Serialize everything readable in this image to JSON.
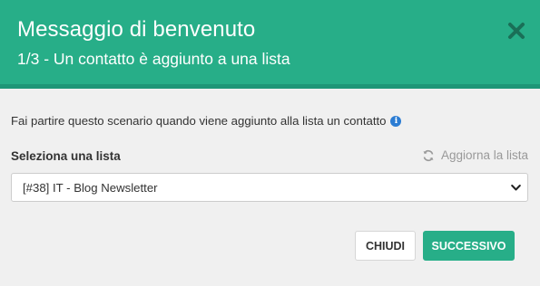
{
  "header": {
    "title": "Messaggio di benvenuto",
    "subtitle": "1/3 - Un contatto è aggiunto a una lista"
  },
  "body": {
    "description": "Fai partire questo scenario quando viene aggiunto alla lista un contatto",
    "select_label": "Seleziona una lista",
    "refresh_label": "Aggiorna la lista",
    "select_value": "[#38] IT - Blog Newsletter"
  },
  "footer": {
    "close_label": "CHIUDI",
    "next_label": "SUCCESSIVO"
  },
  "colors": {
    "accent": "#27ae88",
    "accent_dark": "#1e9677",
    "info": "#2b7cd3",
    "background": "#f0f0f0"
  },
  "icons": {
    "close": "close-icon",
    "info": "info-icon",
    "refresh": "refresh-icon",
    "select": "chevron-down-icon"
  }
}
